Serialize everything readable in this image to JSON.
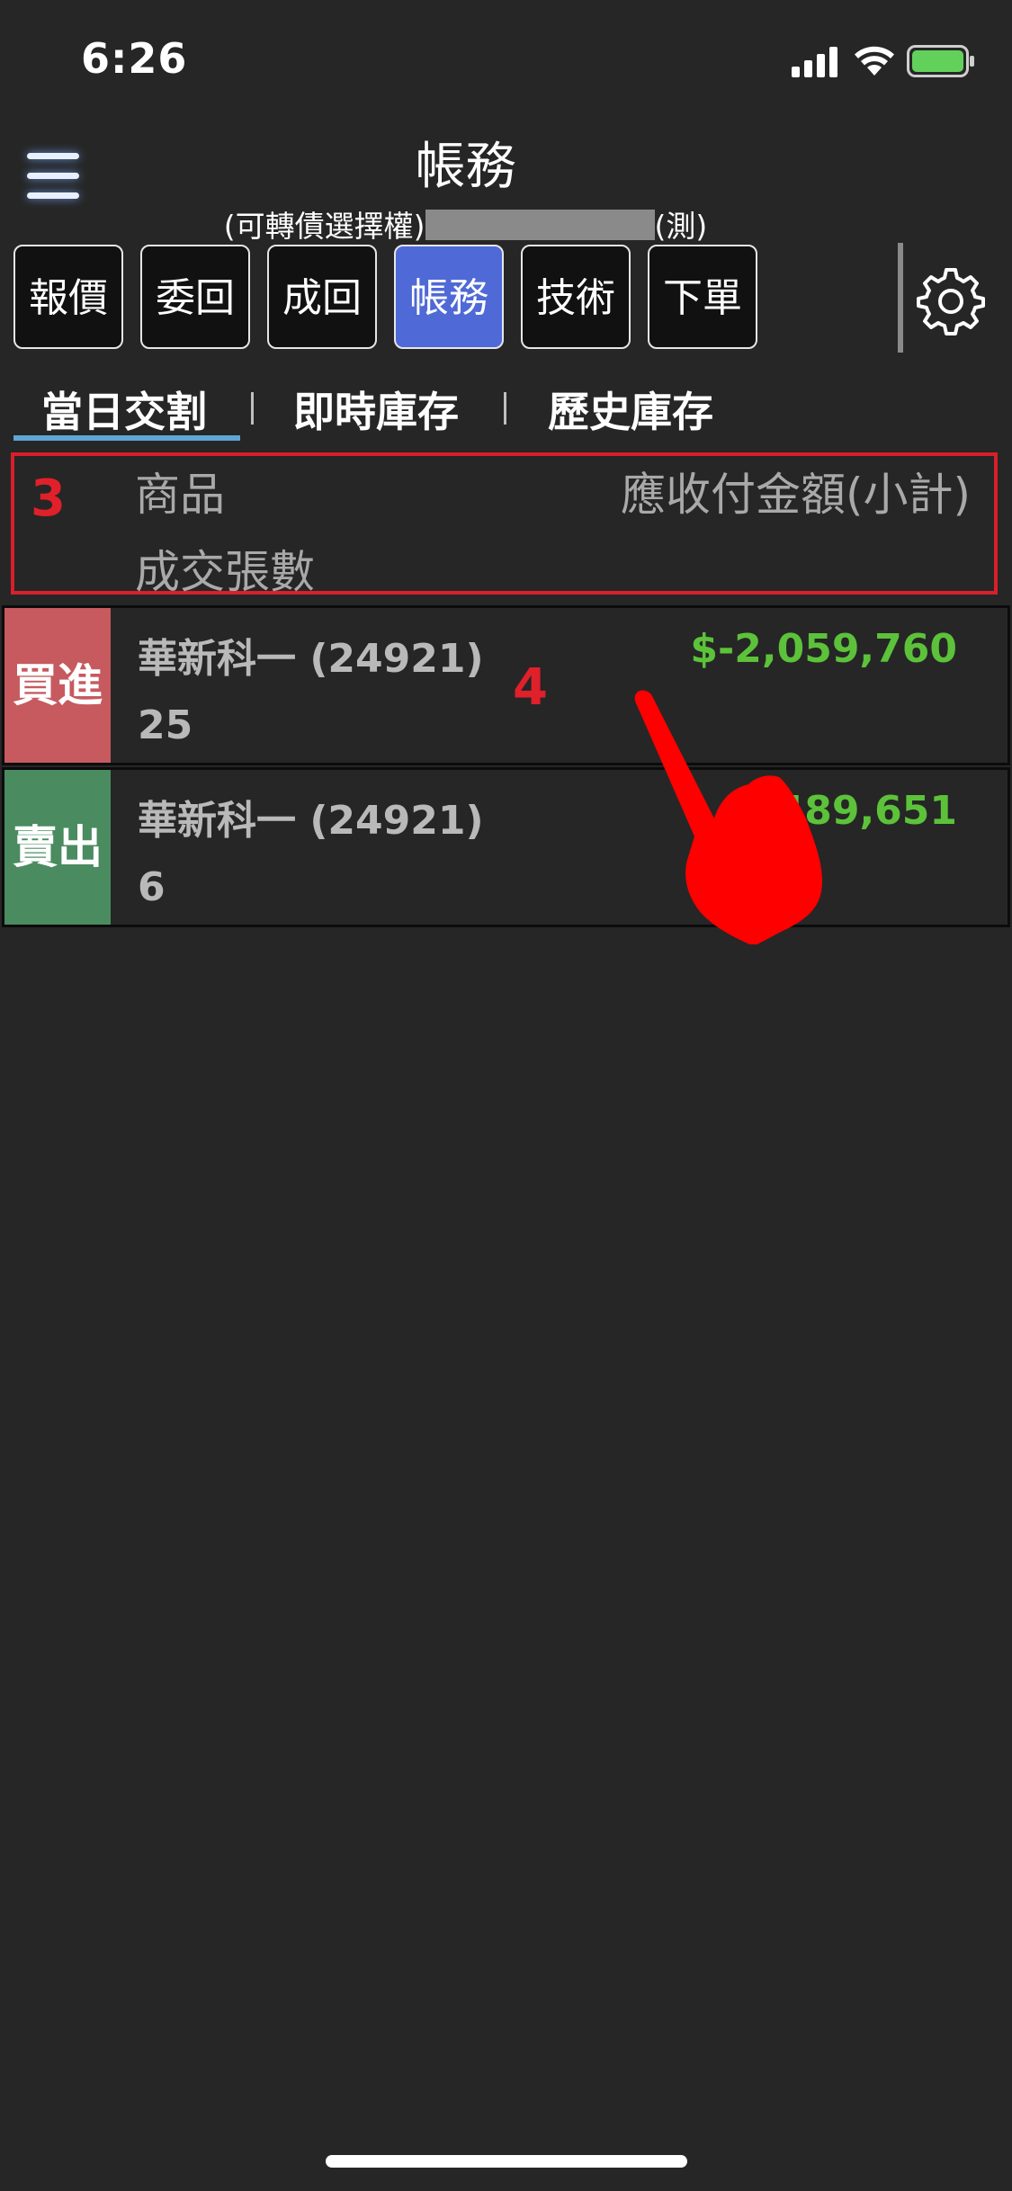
{
  "status_bar": {
    "time": "6:26"
  },
  "header": {
    "title": "帳務",
    "account_prefix": "(可轉債選擇權)",
    "account_suffix": "(測)"
  },
  "function_tabs": [
    {
      "label": "報價",
      "active": false
    },
    {
      "label": "委回",
      "active": false
    },
    {
      "label": "成回",
      "active": false
    },
    {
      "label": "帳務",
      "active": true
    },
    {
      "label": "技術",
      "active": false
    },
    {
      "label": "下單",
      "active": false
    }
  ],
  "sub_tabs": [
    {
      "label": "當日交割",
      "active": true
    },
    {
      "label": "即時庫存",
      "active": false
    },
    {
      "label": "歷史庫存",
      "active": false
    }
  ],
  "legend": {
    "marker": "3",
    "product_label": "商品",
    "amount_label": "應收付金額(小計)",
    "qty_label": "成交張數"
  },
  "annotation": {
    "marker": "4"
  },
  "rows": [
    {
      "side": "買進",
      "name": "華新科一 (24921)",
      "qty": "25",
      "amount": "$-2,059,760"
    },
    {
      "side": "賣出",
      "name": "華新科一 (24921)",
      "qty": "6",
      "amount": "489,651"
    }
  ],
  "colors": {
    "background": "#262626",
    "active_tab": "#4f6ad6",
    "buy": "#c65a5f",
    "sell": "#4a8b60",
    "amount": "#5cc23a",
    "annotation_red": "#d81f2a"
  }
}
